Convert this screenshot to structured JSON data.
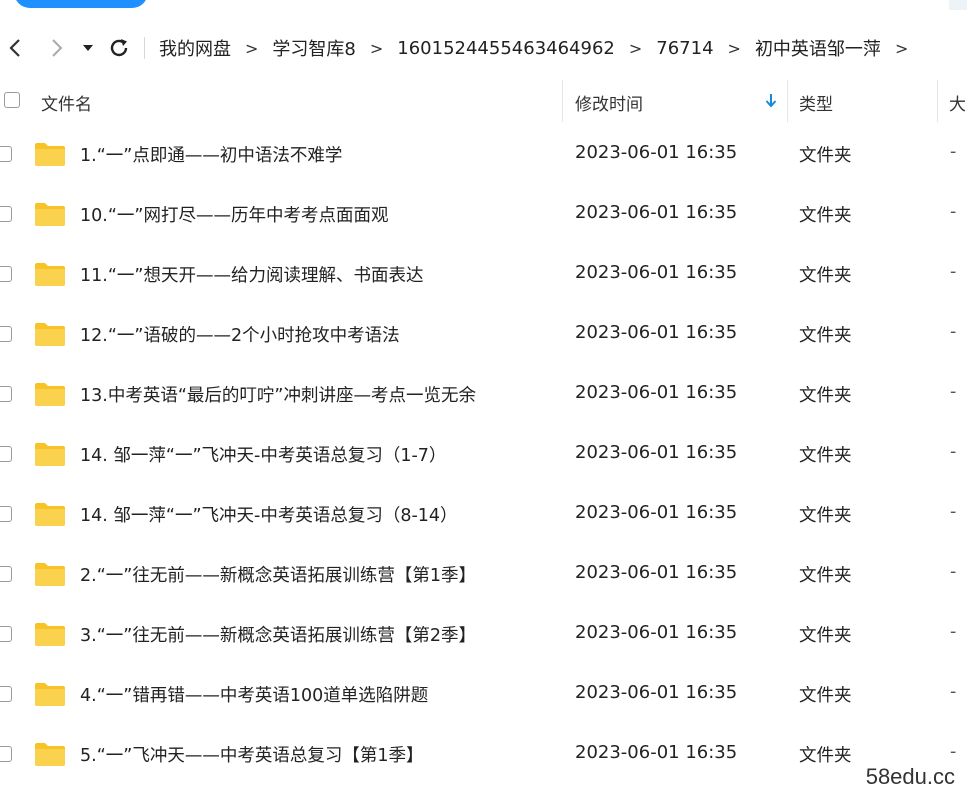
{
  "breadcrumb": [
    "我的网盘",
    "学习智库8",
    "1601524455463464962",
    "76714",
    "初中英语邹一萍"
  ],
  "breadcrumb_sep": ">",
  "columns": {
    "name": "文件名",
    "modified": "修改时间",
    "type": "类型",
    "size": "大"
  },
  "rows": [
    {
      "name": "1.“一”点即通——初中语法不难学",
      "date": "2023-06-01 16:35",
      "type": "文件夹",
      "size": "-"
    },
    {
      "name": "10.“一”网打尽——历年中考考点面面观",
      "date": "2023-06-01 16:35",
      "type": "文件夹",
      "size": "-"
    },
    {
      "name": "11.“一”想天开——给力阅读理解、书面表达",
      "date": "2023-06-01 16:35",
      "type": "文件夹",
      "size": "-"
    },
    {
      "name": "12.“一”语破的——2个小时抢攻中考语法",
      "date": "2023-06-01 16:35",
      "type": "文件夹",
      "size": "-"
    },
    {
      "name": "13.中考英语“最后的叮咛”冲刺讲座—考点一览无余",
      "date": "2023-06-01 16:35",
      "type": "文件夹",
      "size": "-"
    },
    {
      "name": "14. 邹一萍“一”飞冲天-中考英语总复习（1-7）",
      "date": "2023-06-01 16:35",
      "type": "文件夹",
      "size": "-"
    },
    {
      "name": "14. 邹一萍“一”飞冲天-中考英语总复习（8-14）",
      "date": "2023-06-01 16:35",
      "type": "文件夹",
      "size": "-"
    },
    {
      "name": "2.“一”往无前——新概念英语拓展训练营【第1季】",
      "date": "2023-06-01 16:35",
      "type": "文件夹",
      "size": "-"
    },
    {
      "name": "3.“一”往无前——新概念英语拓展训练营【第2季】",
      "date": "2023-06-01 16:35",
      "type": "文件夹",
      "size": "-"
    },
    {
      "name": "4.“一”错再错——中考英语100道单选陷阱题",
      "date": "2023-06-01 16:35",
      "type": "文件夹",
      "size": "-"
    },
    {
      "name": "5.“一”飞冲天——中考英语总复习【第1季】",
      "date": "2023-06-01 16:35",
      "type": "文件夹",
      "size": "-"
    }
  ],
  "watermark": "58edu.cc",
  "icons": {
    "back": "chevron-left-icon",
    "forward": "chevron-right-icon",
    "history": "caret-down-icon",
    "refresh": "refresh-icon",
    "sort": "sort-down-arrow-icon",
    "folder": "folder-icon"
  },
  "colors": {
    "folder": "#f7c325",
    "sort_arrow": "#1a8ad8",
    "accent": "#1e90ff"
  }
}
